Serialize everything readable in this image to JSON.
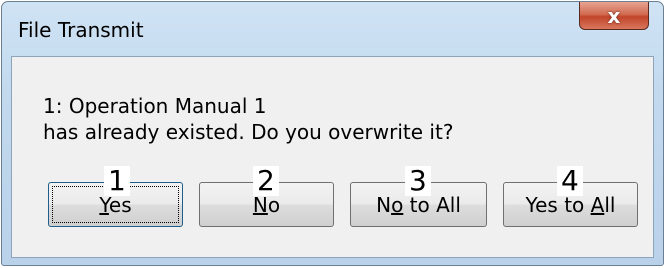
{
  "window": {
    "title": "File Transmit",
    "close_icon": "close-x-icon",
    "close_glyph": "x"
  },
  "message": {
    "line1": "1: Operation Manual 1",
    "line2": "has already existed.  Do you overwrite it?"
  },
  "buttons": [
    {
      "pre": "",
      "key": "Y",
      "post": "es",
      "label": "Yes",
      "callout": "1"
    },
    {
      "pre": "",
      "key": "N",
      "post": "o",
      "label": "No",
      "callout": "2"
    },
    {
      "pre": "N",
      "key": "o",
      "post": " to All",
      "label": "No to All",
      "callout": "3"
    },
    {
      "pre": "Yes to ",
      "key": "A",
      "post": "ll",
      "label": "Yes to All",
      "callout": "4"
    }
  ],
  "colors": {
    "frame": "#c2d9ee",
    "close_button": "#c2452a",
    "client_bg": "#f0f0f0"
  }
}
